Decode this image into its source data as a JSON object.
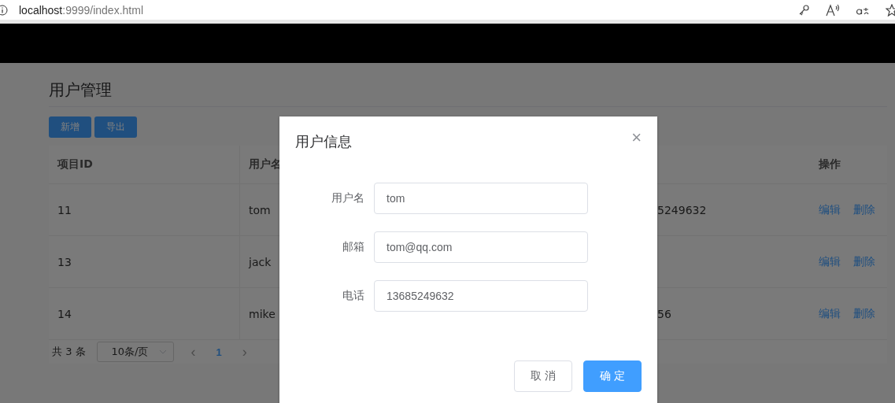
{
  "browser": {
    "url_host": "localhost",
    "url_rest": ":9999/index.html"
  },
  "page": {
    "title": "用户管理",
    "buttons": [
      "新增",
      "导出"
    ]
  },
  "table": {
    "columns": [
      "项目ID",
      "用户名",
      "",
      "操作"
    ],
    "rows": [
      {
        "cells": [
          "11",
          "tom",
          "5249632"
        ],
        "actions": [
          "编辑",
          "删除"
        ]
      },
      {
        "cells": [
          "13",
          "jack",
          ""
        ],
        "actions": [
          "编辑",
          "删除"
        ]
      },
      {
        "cells": [
          "14",
          "mike",
          "56"
        ],
        "actions": [
          "编辑",
          "删除"
        ]
      }
    ]
  },
  "pagination": {
    "total": "共 3 条",
    "page_size": "10条/页",
    "prev": "‹",
    "pages": [
      {
        "label": "1",
        "selected": true
      }
    ],
    "next": "›"
  },
  "dialog": {
    "title": "用户信息",
    "close": "×",
    "fields": [
      {
        "label": "用户名",
        "value": "tom"
      },
      {
        "label": "邮箱",
        "value": "tom@qq.com"
      },
      {
        "label": "电话",
        "value": "13685249632"
      }
    ],
    "buttons": [
      {
        "label": "取 消",
        "kind": "default"
      },
      {
        "label": "确 定",
        "kind": "primary"
      }
    ]
  }
}
